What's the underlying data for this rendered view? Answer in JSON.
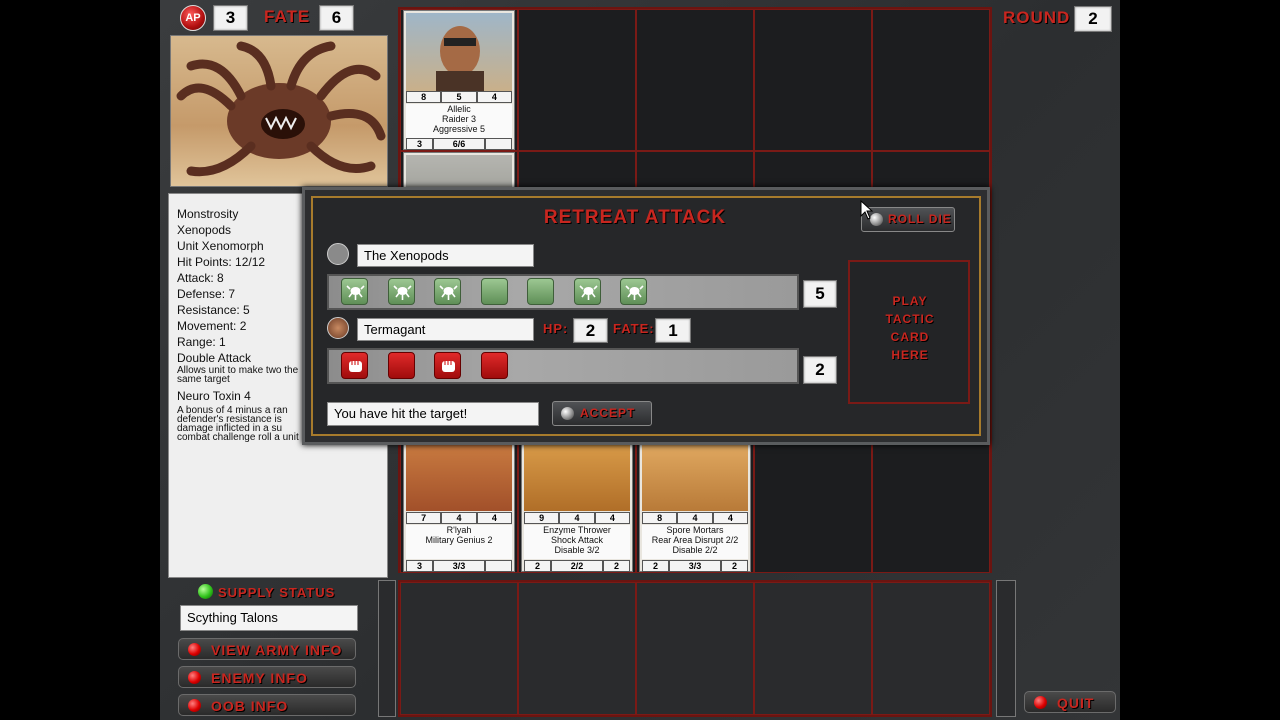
{
  "hud": {
    "ap_label": "AP",
    "ap_value": "3",
    "fate_label": "FATE",
    "fate_value": "6",
    "round_label": "ROUND",
    "round_value": "2"
  },
  "unit_info": {
    "lines": [
      "Monstrosity",
      "Xenopods",
      "Unit Xenomorph",
      "Hit Points: 12/12",
      "Attack: 8",
      "Defense: 7",
      "Resistance: 5",
      "Movement: 2",
      "Range: 1",
      "Double Attack"
    ],
    "double_attack_desc": "Allows unit to make two the same target",
    "neuro_toxin": "Neuro Toxin 4",
    "neuro_toxin_desc": "A bonus of 4 minus a ran defender's resistance is damage inflicted in a su combat challenge roll a unit"
  },
  "cards": [
    {
      "id": "allelic",
      "stats_top": [
        "8",
        "5",
        "4"
      ],
      "name": "Allelic",
      "line2": "Raider 3",
      "line3": "Aggressive 5",
      "stats_bottom": [
        "3",
        "6/6",
        ""
      ]
    },
    {
      "id": "rlyah",
      "stats_top": [
        "7",
        "4",
        "4"
      ],
      "name": "R'lyah",
      "line2": "Military Genius 2",
      "line3": "",
      "stats_bottom": [
        "3",
        "3/3",
        ""
      ]
    },
    {
      "id": "enzyme",
      "stats_top": [
        "9",
        "4",
        "4"
      ],
      "name": "Enzyme Thrower",
      "line2": "Shock Attack",
      "line3": "Disable 3/2",
      "stats_bottom": [
        "2",
        "2/2",
        "2"
      ]
    },
    {
      "id": "spore",
      "stats_top": [
        "8",
        "4",
        "4"
      ],
      "name": "Spore Mortars",
      "line2": "Rear Area   Disrupt 2/2",
      "line3": "Disable 2/2",
      "stats_bottom": [
        "2",
        "3/3",
        "2"
      ]
    }
  ],
  "dialog": {
    "title": "RETREAT ATTACK",
    "roll_die_label": "ROLL DIE",
    "attacker_name": "The Xenopods",
    "attacker_score": "5",
    "defender_name": "Termagant",
    "hp_label": "HP:",
    "hp_value": "2",
    "fate_label": "FATE:",
    "fate_value": "1",
    "defender_score": "2",
    "tactic_text": "PLAY TACTIC CARD HERE",
    "result_text": "You have hit the target!",
    "accept_label": "ACCEPT",
    "attacker_dice": [
      "hit",
      "hit",
      "hit",
      "blank",
      "blank",
      "hit",
      "hit"
    ],
    "defender_dice": [
      "hit",
      "blank",
      "hit",
      "blank"
    ]
  },
  "sidebar": {
    "supply_label": "SUPPLY STATUS",
    "weapon_field": "Scything Talons",
    "view_army_label": "VIEW ARMY INFO",
    "enemy_info_label": "ENEMY INFO",
    "oob_info_label": "OOB INFO"
  },
  "quit_label": "QUIT",
  "colors": {
    "accent_red": "#c8261f",
    "panel_bg": "#2b2c2e",
    "grid_line": "#7a1a16",
    "die_green": "#7fae76",
    "die_red": "#c81818"
  }
}
